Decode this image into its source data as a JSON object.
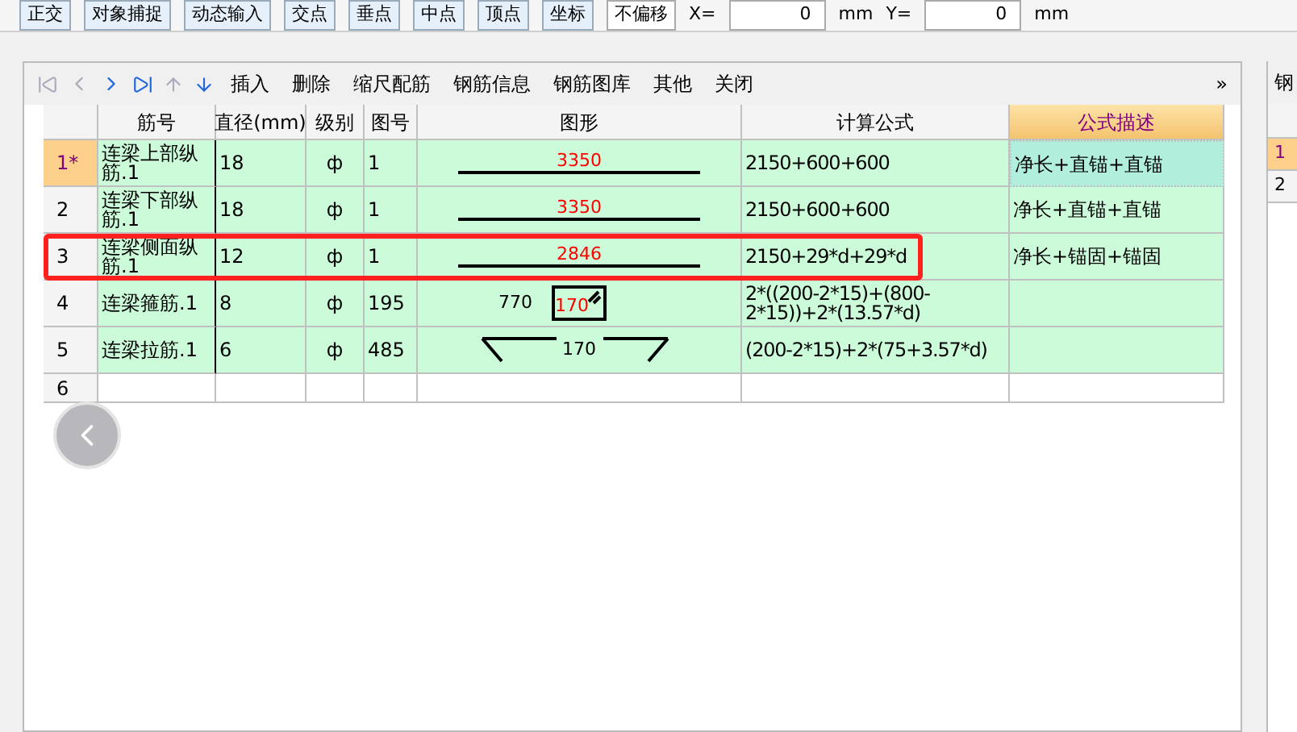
{
  "top_toolbar": {
    "items": [
      "正交",
      "对象捕捉",
      "动态输入",
      "交点",
      "垂点",
      "中点",
      "顶点",
      "坐标"
    ],
    "offset_select": "不偏移",
    "x_label": "X=",
    "x_value": "0",
    "x_unit": "mm",
    "y_label": "Y=",
    "y_value": "0",
    "y_unit": "mm"
  },
  "toolbar": {
    "buttons": [
      "插入",
      "删除",
      "缩尺配筋",
      "钢筋信息",
      "钢筋图库",
      "其他",
      "关闭"
    ],
    "more": "»"
  },
  "table": {
    "columns": [
      "筋号",
      "直径(mm)",
      "级别",
      "图号",
      "图形",
      "计算公式",
      "公式描述"
    ],
    "rows": [
      {
        "index": "1*",
        "selected": true,
        "highlighted": false,
        "name": "连梁上部纵筋.1",
        "diameter": "18",
        "grade": "ф",
        "figure_no": "1",
        "shape": {
          "kind": "line",
          "label": "3350"
        },
        "formula": "2150+600+600",
        "description": "净长+直锚+直锚",
        "focused": true
      },
      {
        "index": "2",
        "selected": false,
        "highlighted": false,
        "name": "连梁下部纵筋.1",
        "diameter": "18",
        "grade": "ф",
        "figure_no": "1",
        "shape": {
          "kind": "line",
          "label": "3350"
        },
        "formula": "2150+600+600",
        "description": "净长+直锚+直锚",
        "focused": false
      },
      {
        "index": "3",
        "selected": false,
        "highlighted": true,
        "name": "连梁侧面纵筋.1",
        "diameter": "12",
        "grade": "ф",
        "figure_no": "1",
        "shape": {
          "kind": "line",
          "label": "2846"
        },
        "formula": "2150+29*d+29*d",
        "description": "净长+锚固+锚固",
        "focused": false
      },
      {
        "index": "4",
        "selected": false,
        "highlighted": false,
        "name": "连梁箍筋.1",
        "diameter": "8",
        "grade": "ф",
        "figure_no": "195",
        "shape": {
          "kind": "stirrup",
          "label": "170",
          "side_label": "770"
        },
        "formula": "2*((200-2*15)+(800-2*15))+2*(13.57*d)",
        "focused": false
      },
      {
        "index": "5",
        "selected": false,
        "highlighted": false,
        "name": "连梁拉筋.1",
        "diameter": "6",
        "grade": "ф",
        "figure_no": "485",
        "shape": {
          "kind": "tie",
          "label": "170"
        },
        "formula": "(200-2*15)+2*(75+3.57*d)",
        "focused": false
      },
      {
        "index": "6",
        "selected": false,
        "highlighted": false
      }
    ]
  },
  "side_panel": {
    "title": "钢",
    "rows": [
      {
        "index": "1",
        "selected": true
      },
      {
        "index": "2",
        "selected": false
      }
    ]
  }
}
